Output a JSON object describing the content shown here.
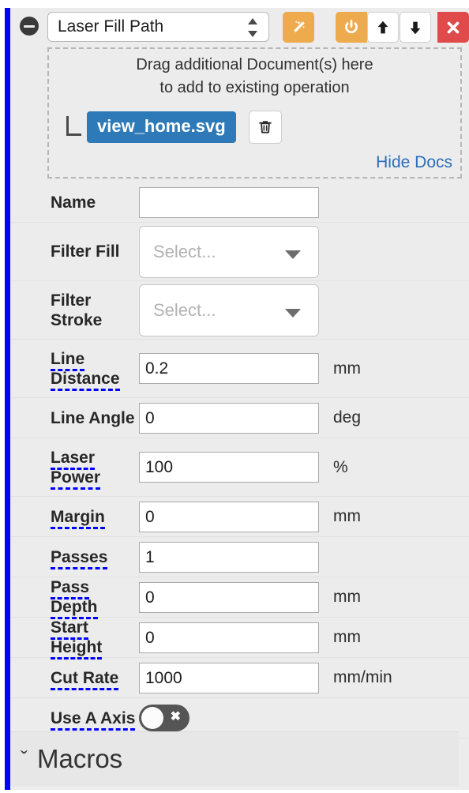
{
  "panel": {
    "collapse_icon": "minus-circle-icon",
    "operation": {
      "selected": "Laser Fill Path",
      "stepper_up_icon": "caret-up-icon",
      "stepper_down_icon": "caret-down-icon"
    },
    "toolbar": {
      "wand_icon": "magic-wand-icon",
      "power_icon": "power-icon",
      "move_up_icon": "arrow-up-icon",
      "move_down_icon": "arrow-down-icon",
      "close_icon": "close-x-icon"
    },
    "colors": {
      "accent_bar": "#0000ff",
      "orange_button": "#eeab4e",
      "red_button": "#e04a4a",
      "doc_chip": "#2e7ab8",
      "link": "#2a6ebb",
      "underline": "#0000ff",
      "panel_bg": "#ececec",
      "toggle_off": "#555555"
    }
  },
  "docs": {
    "drop_line_1": "Drag additional Document(s) here",
    "drop_line_2": "to add to existing operation",
    "document_name": "view_home.svg",
    "delete_icon": "trash-icon",
    "hide_link": "Hide Docs"
  },
  "fields": [
    {
      "label": "Name",
      "underline": false,
      "type": "text",
      "value": "",
      "unit": ""
    },
    {
      "label": "Filter Fill",
      "underline": false,
      "type": "select",
      "value": "Select...",
      "unit": ""
    },
    {
      "label": "Filter Stroke",
      "underline": false,
      "type": "select",
      "value": "Select...",
      "unit": ""
    },
    {
      "label": "Line Distance",
      "underline": true,
      "type": "text",
      "value": "0.2",
      "unit": "mm"
    },
    {
      "label": "Line Angle",
      "underline": false,
      "type": "text",
      "value": "0",
      "unit": "deg"
    },
    {
      "label": "Laser Power",
      "underline": true,
      "type": "text",
      "value": "100",
      "unit": "%"
    },
    {
      "label": "Margin",
      "underline": true,
      "type": "text",
      "value": "0",
      "unit": "mm"
    },
    {
      "label": "Passes",
      "underline": true,
      "type": "text",
      "value": "1",
      "unit": ""
    },
    {
      "label": "Pass Depth",
      "underline": true,
      "type": "text",
      "value": "0",
      "unit": "mm"
    },
    {
      "label": "Start Height",
      "underline": true,
      "type": "text",
      "value": "0",
      "unit": "mm"
    },
    {
      "label": "Cut Rate",
      "underline": true,
      "type": "text",
      "value": "1000",
      "unit": "mm/min"
    },
    {
      "label": "Use A Axis",
      "underline": true,
      "type": "toggle",
      "value": "off",
      "unit": ""
    }
  ],
  "macros": {
    "title": "Macros",
    "chevron": "ˇ",
    "expanded": false
  }
}
